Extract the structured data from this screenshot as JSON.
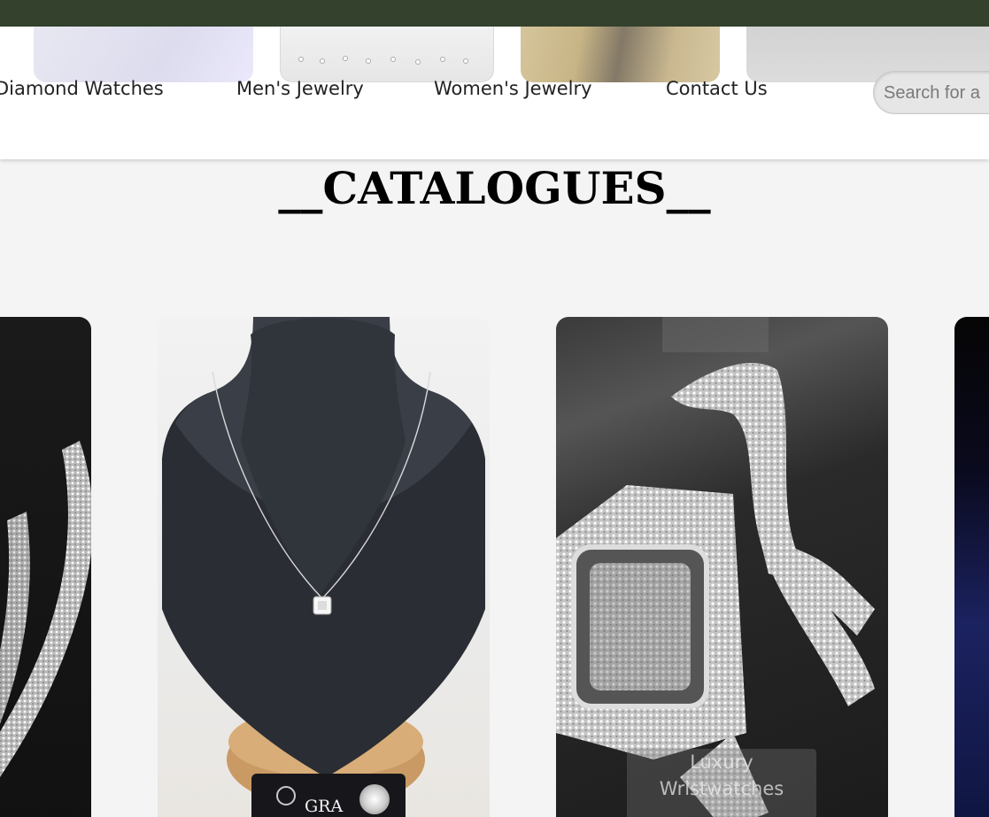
{
  "header": {
    "nav": [
      {
        "label": "Diamond Watches"
      },
      {
        "label": "Men's Jewelry"
      },
      {
        "label": "Women's Jewelry"
      },
      {
        "label": "Contact Us"
      }
    ],
    "search": {
      "placeholder": "Search for a"
    }
  },
  "main": {
    "section_title": "__CATALOGUES__",
    "cards": [
      {
        "name": "cuban-chain-card"
      },
      {
        "name": "necklace-card",
        "certificate_text": "GRA"
      },
      {
        "name": "watch-card",
        "label": "Luxury Wristwatches"
      },
      {
        "name": "blue-card"
      }
    ]
  },
  "colors": {
    "topbar": "#33412d",
    "header_bg": "#ffffff",
    "page_bg": "#f4f4f4"
  }
}
